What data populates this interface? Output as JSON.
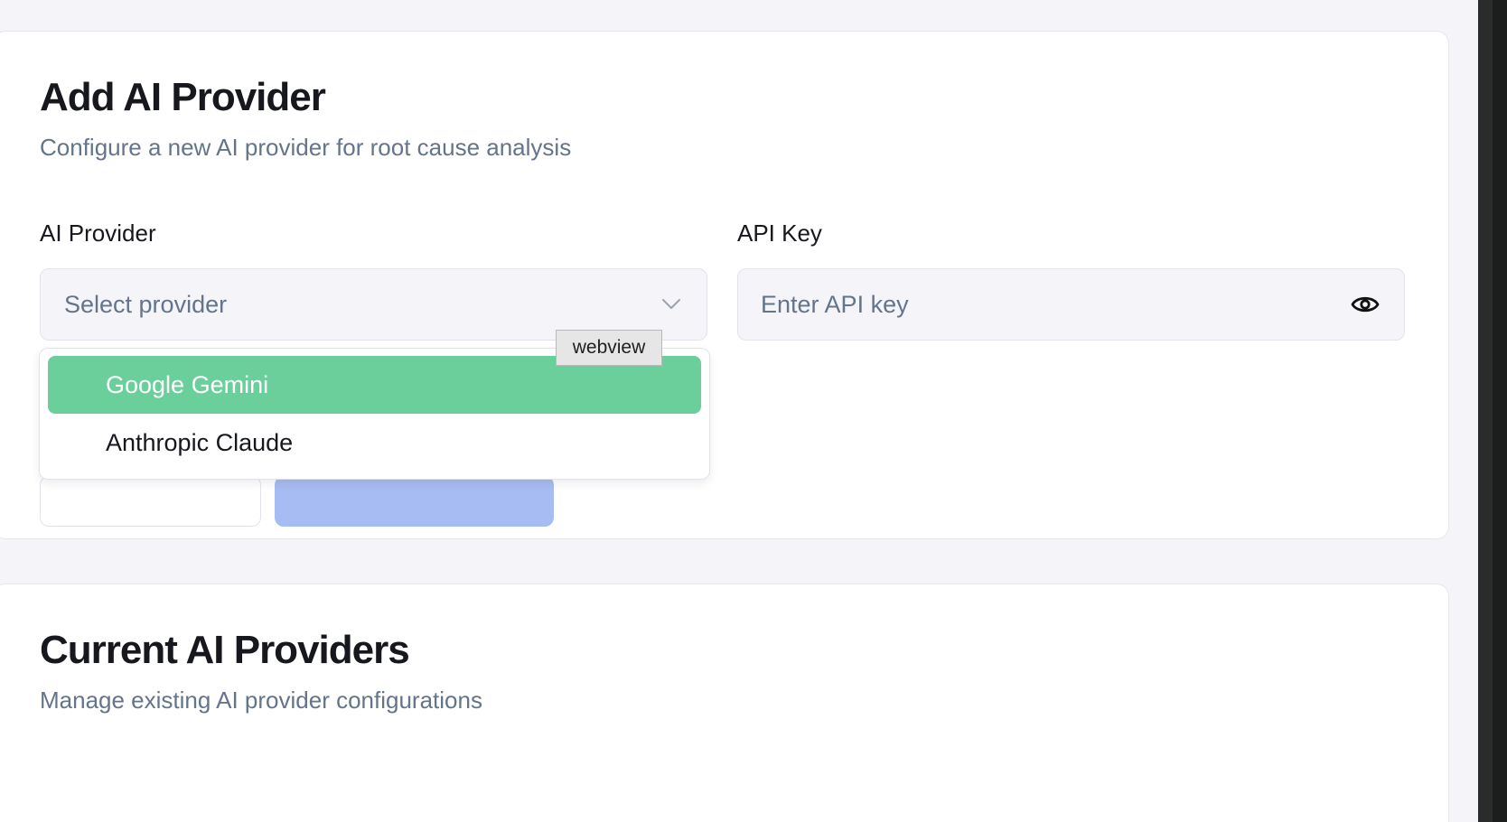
{
  "add_section": {
    "title": "Add AI Provider",
    "subtitle": "Configure a new AI provider for root cause analysis",
    "provider_label": "AI Provider",
    "provider_select": {
      "value": "Select provider",
      "options": [
        "Google Gemini",
        "Anthropic Claude"
      ],
      "highlighted_option": "Google Gemini"
    },
    "api_key_label": "API Key",
    "api_key_input": {
      "value": "",
      "placeholder": "Enter API key"
    }
  },
  "tooltip": {
    "text": "webview"
  },
  "current_section": {
    "title": "Current AI Providers",
    "subtitle": "Manage existing AI provider configurations"
  },
  "icons": {
    "select_chevron": "chevron-down-icon",
    "api_key_toggle": "eye-icon"
  },
  "colors": {
    "highlight": "#6bcf9c",
    "primary_button_disabled": "#a7bcf2",
    "muted_text": "#64748b"
  }
}
